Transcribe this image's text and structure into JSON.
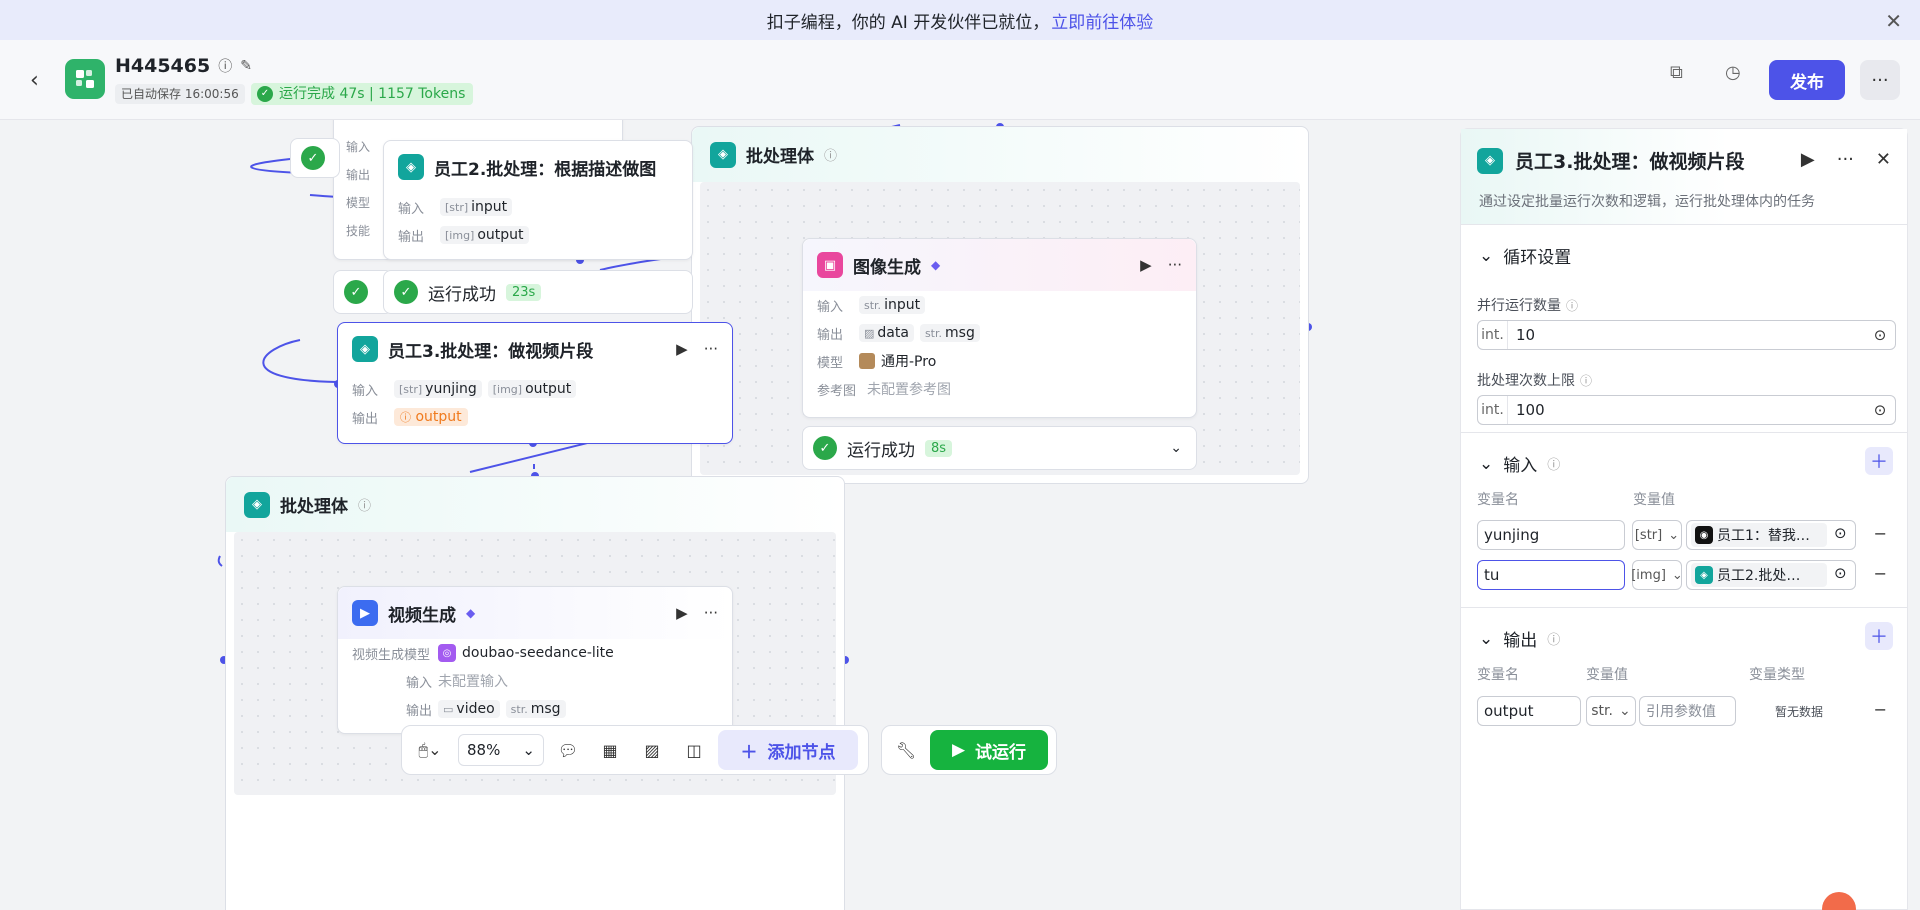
{
  "banner": {
    "text": "扣子编程，你的 AI 开发伙伴已就位，",
    "link": "立即前往体验"
  },
  "header": {
    "title": "H445465",
    "saved": "已自动保存 16:00:56",
    "run_status": "运行完成 47s | 1157 Tokens",
    "publish_label": "发布"
  },
  "canvas": {
    "top_group": {
      "title": "批处理体"
    },
    "bottom_group": {
      "title": "批处理体"
    },
    "node_employee2": {
      "title": "员工2.批处理：根据描述做图",
      "in_label": "输入",
      "in_val": "input",
      "out_label": "输出",
      "out_val": "output"
    },
    "partial_node": {
      "labels": [
        "输入",
        "输出",
        "模型",
        "技能"
      ]
    },
    "status_emp2": {
      "text": "运行成功",
      "time": "23s"
    },
    "node_employee3": {
      "title": "员工3.批处理：做视频片段",
      "in_label": "输入",
      "in_val1": "yunjing",
      "in_val2": "output",
      "out_label": "输出",
      "out_val": "output"
    },
    "node_image": {
      "title": "图像生成",
      "in_label": "输入",
      "in_val": "input",
      "out_label": "输出",
      "out_val1": "data",
      "out_val2": "msg",
      "model_label": "模型",
      "model_val": "通用-Pro",
      "ref_label": "参考图",
      "ref_val": "未配置参考图"
    },
    "status_image": {
      "text": "运行成功",
      "time": "8s"
    },
    "node_video": {
      "title": "视频生成",
      "model_label": "视频生成模型",
      "model_val": "doubao-seedance-lite",
      "in_label": "输入",
      "in_val": "未配置输入",
      "out_label": "输出",
      "out_val1": "video",
      "out_val2": "msg"
    }
  },
  "toolbar": {
    "zoom": "88%",
    "add_node": "添加节点",
    "try_run": "试运行"
  },
  "panel": {
    "title": "员工3.批处理：做视频片段",
    "desc": "通过设定批量运行次数和逻辑，运行批处理体内的任务",
    "loop": {
      "title": "循环设置",
      "parallel_label": "并行运行数量",
      "parallel_type": "int.",
      "parallel_val": "10",
      "max_label": "批处理次数上限",
      "max_type": "int.",
      "max_val": "100"
    },
    "input": {
      "title": "输入",
      "col_name": "变量名",
      "col_val": "变量值",
      "rows": [
        {
          "name": "yunjing",
          "type": "[str]",
          "ref": "员工1：替我…"
        },
        {
          "name": "tu",
          "type": "[img]",
          "ref": "员工2.批处…"
        }
      ]
    },
    "output": {
      "title": "输出",
      "col_name": "变量名",
      "col_val": "变量值",
      "col_type": "变量类型",
      "row": {
        "name": "output",
        "type": "str.",
        "placeholder": "引用参数值",
        "var_type": "暂无数据"
      }
    }
  }
}
